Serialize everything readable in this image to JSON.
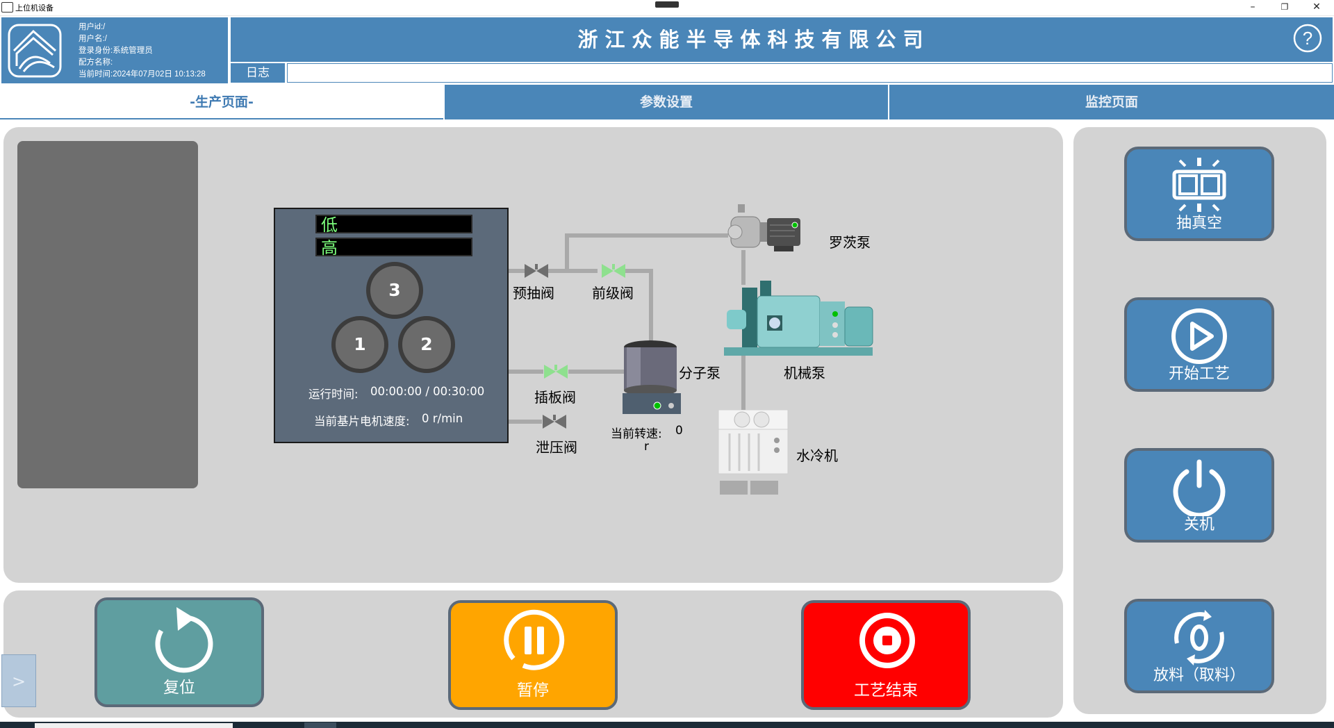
{
  "window": {
    "title": "上位机设备",
    "minimize": "–",
    "maximize": "❐",
    "close": "✕"
  },
  "user_info": {
    "user_id": "用户id:/",
    "user_name": "用户名:/",
    "role": "登录身份:系统管理员",
    "recipe": "配方名称:",
    "time": "当前时间:2024年07月02日 10:13:28"
  },
  "header": {
    "company": "浙江众能半导体科技有限公司",
    "help_icon": "question-mark-icon",
    "log_label": "日志",
    "log_value": ""
  },
  "tabs": [
    {
      "label": "-生产页面-",
      "active": true
    },
    {
      "label": "参数设置",
      "active": false
    },
    {
      "label": "监控页面",
      "active": false
    }
  ],
  "chamber": {
    "level_low": "低",
    "level_high": "高",
    "discs": [
      "3",
      "1",
      "2"
    ],
    "run_time_label": "运行时间:",
    "run_time_value": "00:00:00 / 00:30:00",
    "motor_speed_label": "当前基片电机速度:",
    "motor_speed_value": "0 r/min"
  },
  "components": {
    "roots_pump": "罗茨泵",
    "pre_pump_valve": "预抽阀",
    "foreline_valve": "前级阀",
    "mechanical_pump": "机械泵",
    "molecular_pump": "分子泵",
    "gate_valve": "插板阀",
    "vent_valve": "泄压阀",
    "current_speed_label": "当前转速:",
    "current_speed_value": "0",
    "current_speed_unit": "r",
    "water_chiller": "水冷机"
  },
  "valve_states": {
    "pre_pump_valve": "closed",
    "foreline_valve": "open",
    "gate_valve": "open",
    "vent_valve": "closed"
  },
  "colors": {
    "primary": "#4a86b8",
    "panel": "#d3d3d3",
    "valve_open": "#8ee08e",
    "valve_closed": "#6e6e6e",
    "reset": "#5f9ea0",
    "pause": "#ffa500",
    "end": "#ff0000"
  },
  "side_buttons": [
    {
      "label": "抽真空",
      "icon": "vacuum-icon"
    },
    {
      "label": "开始工艺",
      "icon": "play-icon"
    },
    {
      "label": "关机",
      "icon": "power-icon"
    },
    {
      "label": "放料（取料）",
      "icon": "discharge-icon"
    }
  ],
  "bottom_buttons": [
    {
      "label": "复位",
      "icon": "reset-icon"
    },
    {
      "label": "暂停",
      "icon": "pause-icon"
    },
    {
      "label": "工艺结束",
      "icon": "stop-icon"
    }
  ],
  "expander": ">"
}
